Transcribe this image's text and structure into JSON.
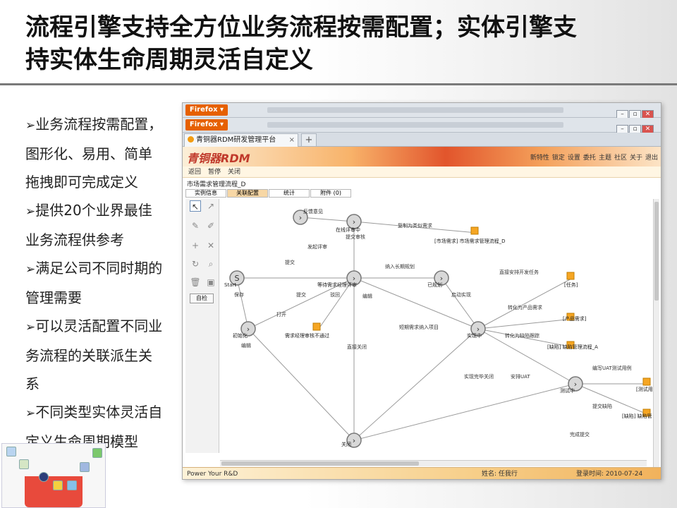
{
  "slide": {
    "title_line1": "流程引擎支持全方位业务流程按需配置；实体引擎支",
    "title_line2": "持实体生命周期灵活自定义"
  },
  "bullets": [
    [
      "业务流程按需配置，",
      "图形化、易用、简单",
      "拖拽即可完成定义"
    ],
    [
      "提供20个业界最佳",
      "业务流程供参考"
    ],
    [
      "满足公司不同时期的",
      "管理需要"
    ],
    [
      "可以灵活配置不同业",
      "务流程的关联派生关",
      "系"
    ],
    [
      "不同类型实体灵活自",
      "定义生命周期模型"
    ]
  ],
  "bullet_marker": "➢",
  "browser": {
    "firefox_label": "Firefox",
    "tab_title": "青铜器RDM研发管理平台",
    "new_tab": "+",
    "window_controls": [
      "–",
      "▫",
      "✕"
    ]
  },
  "app": {
    "logo": "青铜器RDM",
    "header_links": [
      "新特性",
      "锁定",
      "设置",
      "委托",
      "主题",
      "社区",
      "关于",
      "退出"
    ],
    "toolbar": [
      "返回",
      "暂停",
      "关闭"
    ],
    "breadcrumb": "市场需求管理流程_D",
    "tabs": [
      "实例信息",
      "关联配置",
      "统计",
      "附件 (0)"
    ],
    "active_tab": 1,
    "autocheck": "自检",
    "status_left": "Power Your R&D",
    "status_user": "姓名: 任我行",
    "status_login": "登录时间: 2010-07-24 21:04"
  },
  "workflow": {
    "nodes": [
      {
        "id": "start",
        "label": "Start"
      },
      {
        "id": "feedback",
        "label": "反馈意见"
      },
      {
        "id": "online_review",
        "label": "在线评审中"
      },
      {
        "id": "wait_review",
        "label": "等待需求经理评审"
      },
      {
        "id": "planned",
        "label": "已规划"
      },
      {
        "id": "init",
        "label": "初始化"
      },
      {
        "id": "implementing",
        "label": "实现中"
      },
      {
        "id": "testing",
        "label": "测试中"
      },
      {
        "id": "closed",
        "label": "关闭"
      },
      {
        "id": "review_fail",
        "label": "需求经理审核不通过"
      },
      {
        "id": "task",
        "label": "[任务]"
      },
      {
        "id": "product_req",
        "label": "[产品需求]"
      },
      {
        "id": "defect_flow",
        "label": "[缺陷] 缺陷管理流程_A"
      },
      {
        "id": "market_flow",
        "label": "[市场需求] 市场需求管理流程_D"
      },
      {
        "id": "test_link",
        "label": "[测试用"
      },
      {
        "id": "defect_link",
        "label": "[缺陷] 缺陷管"
      }
    ],
    "edge_labels": [
      "提交",
      "保存",
      "打开",
      "编辑",
      "提交",
      "驳回",
      "编辑",
      "发起评审",
      "提交审核",
      "复制为类似需求",
      "纳入长期规划",
      "启动实现",
      "短期需求纳入项目",
      "直接关闭",
      "直接安排开发任务",
      "转化为产品需求",
      "转化为缺陷跟踪",
      "实现完毕关闭",
      "安排UAT",
      "编写UAT测试用例",
      "提交缺陷",
      "完成提交"
    ]
  }
}
